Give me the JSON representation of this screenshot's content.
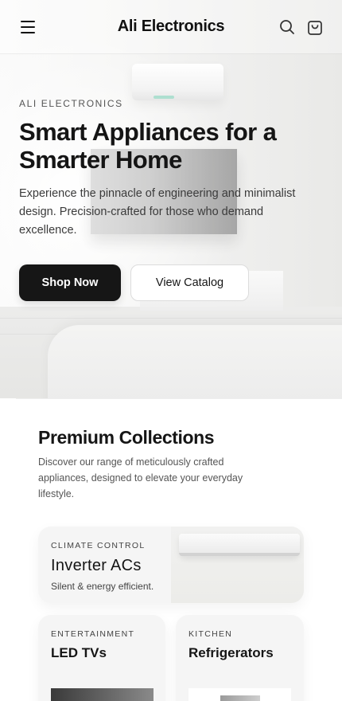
{
  "header": {
    "brand": "Ali Electronics",
    "icons": {
      "menu": "hamburger-menu-icon",
      "search": "search-icon",
      "cart": "shopping-bag-icon"
    }
  },
  "hero": {
    "eyebrow": "ALI ELECTRONICS",
    "title": "Smart Appliances for a Smarter Home",
    "description": "Experience the pinnacle of engineering and minimalist design. Precision-crafted for those who demand excellence.",
    "primary_button": "Shop Now",
    "secondary_button": "View Catalog"
  },
  "collections": {
    "title": "Premium Collections",
    "description": "Discover our range of meticulously crafted appliances, designed to elevate your everyday lifestyle.",
    "cards": [
      {
        "category": "CLIMATE CONTROL",
        "name": "Inverter ACs",
        "subtitle": "Silent & energy efficient."
      },
      {
        "category": "ENTERTAINMENT",
        "name": "LED TVs"
      },
      {
        "category": "KITCHEN",
        "name": "Refrigerators"
      }
    ]
  },
  "colors": {
    "primary_button": "#161616",
    "card_background": "#f5f5f5",
    "text": "#151515"
  }
}
